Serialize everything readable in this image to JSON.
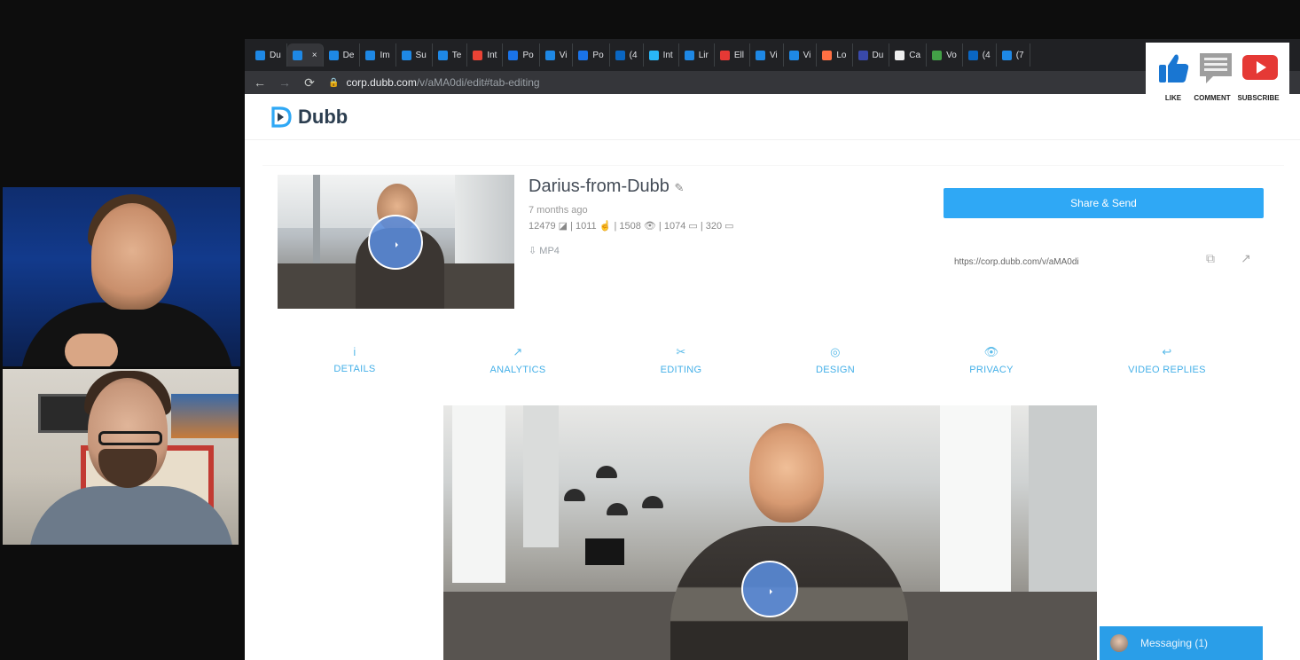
{
  "browser": {
    "tabs": [
      {
        "label": "Du",
        "color": "#1e88e5"
      },
      {
        "label": "",
        "color": "#1e88e5",
        "active": true
      },
      {
        "label": "De",
        "color": "#1e88e5"
      },
      {
        "label": "Im",
        "color": "#1e88e5"
      },
      {
        "label": "Su",
        "color": "#1e88e5"
      },
      {
        "label": "Te",
        "color": "#1e88e5"
      },
      {
        "label": "Int",
        "color": "#ea4335"
      },
      {
        "label": "Po",
        "color": "#1a73e8"
      },
      {
        "label": "Vi",
        "color": "#1e88e5"
      },
      {
        "label": "Po",
        "color": "#1a73e8"
      },
      {
        "label": "(4",
        "color": "#0a66c2"
      },
      {
        "label": "Int",
        "color": "#29b6f6"
      },
      {
        "label": "Lir",
        "color": "#1e88e5"
      },
      {
        "label": "Ell",
        "color": "#e53935"
      },
      {
        "label": "Vi",
        "color": "#1e88e5"
      },
      {
        "label": "Vi",
        "color": "#1e88e5"
      },
      {
        "label": "Lo",
        "color": "#ff7043"
      },
      {
        "label": "Du",
        "color": "#3949ab"
      },
      {
        "label": "Ca",
        "color": "#eeeeee"
      },
      {
        "label": "Vo",
        "color": "#43a047"
      },
      {
        "label": "(4",
        "color": "#0a66c2"
      },
      {
        "label": "(7",
        "color": "#1e88e5"
      }
    ],
    "close_glyph": "×",
    "url_host": "corp.dubb.com",
    "url_path": "/v/aMA0di/edit#tab-editing"
  },
  "overlay": {
    "like": "LIKE",
    "comment": "COMMENT",
    "subscribe": "SUBSCRIBE",
    "like_color": "#1976d2",
    "subscribe_color": "#e53935"
  },
  "app": {
    "brand": "Dubb",
    "brand_color": "#2fa8f5",
    "video": {
      "title": "Darius-from-Dubb",
      "age": "7 months ago",
      "stats": "12479 ◪ | 1011 ☝ | 1508 👁 | 1074 ▭ | 320 ▭",
      "format": "MP4"
    },
    "share": {
      "button": "Share & Send",
      "url": "https://corp.dubb.com/v/aMA0di"
    },
    "tabs": [
      {
        "label": "DETAILS",
        "icon": "i"
      },
      {
        "label": "ANALYTICS",
        "icon": "↗"
      },
      {
        "label": "EDITING",
        "icon": "✂"
      },
      {
        "label": "DESIGN",
        "icon": "◎"
      },
      {
        "label": "PRIVACY",
        "icon": "👁"
      },
      {
        "label": "VIDEO REPLIES",
        "icon": "↩"
      }
    ],
    "messaging": "Messaging (1)"
  }
}
